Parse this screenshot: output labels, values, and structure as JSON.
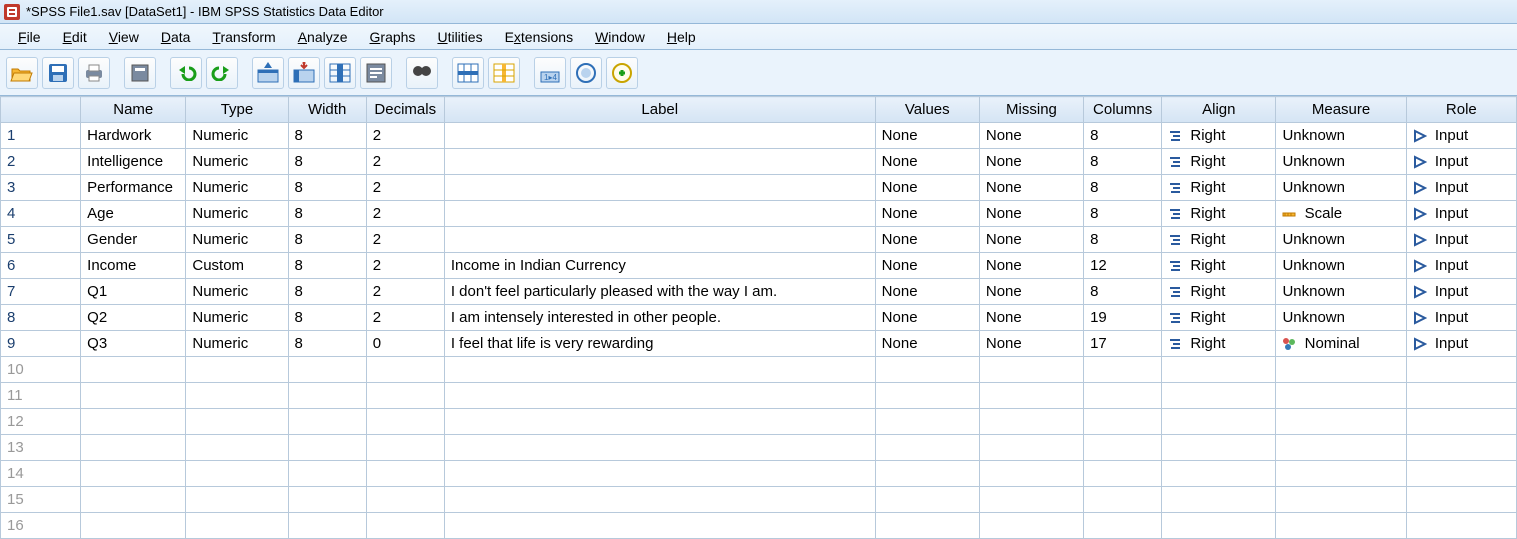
{
  "window": {
    "title": "*SPSS File1.sav [DataSet1] - IBM SPSS Statistics Data Editor"
  },
  "menus": {
    "file": "File",
    "edit": "Edit",
    "view": "View",
    "data": "Data",
    "transform": "Transform",
    "analyze": "Analyze",
    "graphs": "Graphs",
    "utilities": "Utilities",
    "extensions": "Extensions",
    "window": "Window",
    "help": "Help"
  },
  "headers": {
    "name": "Name",
    "type": "Type",
    "width": "Width",
    "decimals": "Decimals",
    "label": "Label",
    "values": "Values",
    "missing": "Missing",
    "columns": "Columns",
    "align": "Align",
    "measure": "Measure",
    "role": "Role"
  },
  "rows": [
    {
      "n": "1",
      "name": "Hardwork",
      "type": "Numeric",
      "width": "8",
      "dec": "2",
      "label": "",
      "values": "None",
      "missing": "None",
      "columns": "8",
      "align": "Right",
      "measure": "Unknown",
      "role": "Input"
    },
    {
      "n": "2",
      "name": "Intelligence",
      "type": "Numeric",
      "width": "8",
      "dec": "2",
      "label": "",
      "values": "None",
      "missing": "None",
      "columns": "8",
      "align": "Right",
      "measure": "Unknown",
      "role": "Input"
    },
    {
      "n": "3",
      "name": "Performance",
      "type": "Numeric",
      "width": "8",
      "dec": "2",
      "label": "",
      "values": "None",
      "missing": "None",
      "columns": "8",
      "align": "Right",
      "measure": "Unknown",
      "role": "Input"
    },
    {
      "n": "4",
      "name": "Age",
      "type": "Numeric",
      "width": "8",
      "dec": "2",
      "label": "",
      "values": "None",
      "missing": "None",
      "columns": "8",
      "align": "Right",
      "measure": "Scale",
      "role": "Input"
    },
    {
      "n": "5",
      "name": "Gender",
      "type": "Numeric",
      "width": "8",
      "dec": "2",
      "label": "",
      "values": "None",
      "missing": "None",
      "columns": "8",
      "align": "Right",
      "measure": "Unknown",
      "role": "Input"
    },
    {
      "n": "6",
      "name": "Income",
      "type": "Custom",
      "width": "8",
      "dec": "2",
      "label": "Income in Indian Currency",
      "values": "None",
      "missing": "None",
      "columns": "12",
      "align": "Right",
      "measure": "Unknown",
      "role": "Input"
    },
    {
      "n": "7",
      "name": "Q1",
      "type": "Numeric",
      "width": "8",
      "dec": "2",
      "label": "I don't feel particularly pleased with the way I am.",
      "values": "None",
      "missing": "None",
      "columns": "8",
      "align": "Right",
      "measure": "Unknown",
      "role": "Input"
    },
    {
      "n": "8",
      "name": "Q2",
      "type": "Numeric",
      "width": "8",
      "dec": "2",
      "label": "I am intensely interested in other people.",
      "values": "None",
      "missing": "None",
      "columns": "19",
      "align": "Right",
      "measure": "Unknown",
      "role": "Input"
    },
    {
      "n": "9",
      "name": "Q3",
      "type": "Numeric",
      "width": "8",
      "dec": "0",
      "label": "I feel that life is very rewarding",
      "values": "None",
      "missing": "None",
      "columns": "17",
      "align": "Right",
      "measure": "Nominal",
      "role": "Input"
    }
  ],
  "empty_rows": [
    "10",
    "11",
    "12",
    "13",
    "14",
    "15",
    "16"
  ],
  "icons": {
    "align_right": "align-right",
    "measure_unknown": "unknown",
    "measure_scale": "scale",
    "measure_nominal": "nominal",
    "role_input": "input"
  }
}
